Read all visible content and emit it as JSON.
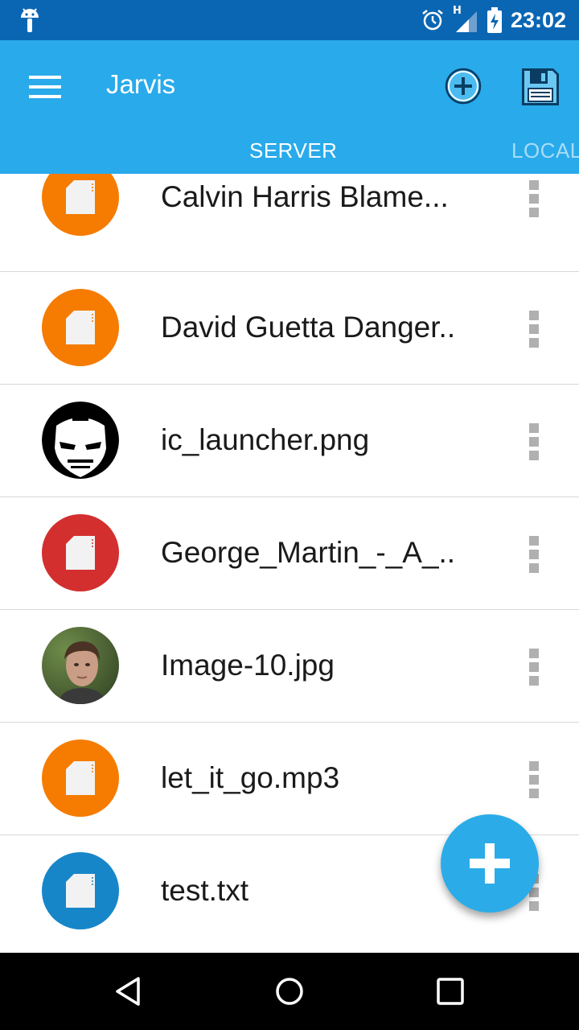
{
  "status_bar": {
    "time": "23:02",
    "network_label": "H",
    "icons": [
      "android-icon",
      "alarm-icon",
      "signal-icon",
      "battery-charging-icon"
    ]
  },
  "app_bar": {
    "title": "Jarvis",
    "icons": [
      "menu-icon",
      "add-circle-icon",
      "save-icon"
    ],
    "tabs": [
      {
        "label": "SERVER",
        "selected": true
      },
      {
        "label": "LOCAL",
        "selected": false
      }
    ]
  },
  "files": [
    {
      "name": "Calvin Harris Blame...",
      "icon": "file-icon",
      "color": "#f57c00"
    },
    {
      "name": "David Guetta Danger..",
      "icon": "file-icon",
      "color": "#f57c00"
    },
    {
      "name": "ic_launcher.png",
      "icon": "iron-man-thumbnail",
      "color": "#000000"
    },
    {
      "name": "George_Martin_-_A_..",
      "icon": "file-icon",
      "color": "#d32f2f"
    },
    {
      "name": "Image-10.jpg",
      "icon": "photo-thumbnail",
      "color": "#3e5a2c"
    },
    {
      "name": "let_it_go.mp3",
      "icon": "file-icon",
      "color": "#f57c00"
    },
    {
      "name": "test.txt",
      "icon": "file-icon",
      "color": "#1786c9"
    }
  ],
  "fab": {
    "icon": "plus-icon",
    "color": "#2bace8"
  },
  "colors": {
    "status_bar": "#0a66b3",
    "app_bar": "#29aaea",
    "tab_inactive": "#a8dcf7"
  },
  "navigation": {
    "icons": [
      "back-icon",
      "home-icon",
      "recents-icon"
    ]
  }
}
